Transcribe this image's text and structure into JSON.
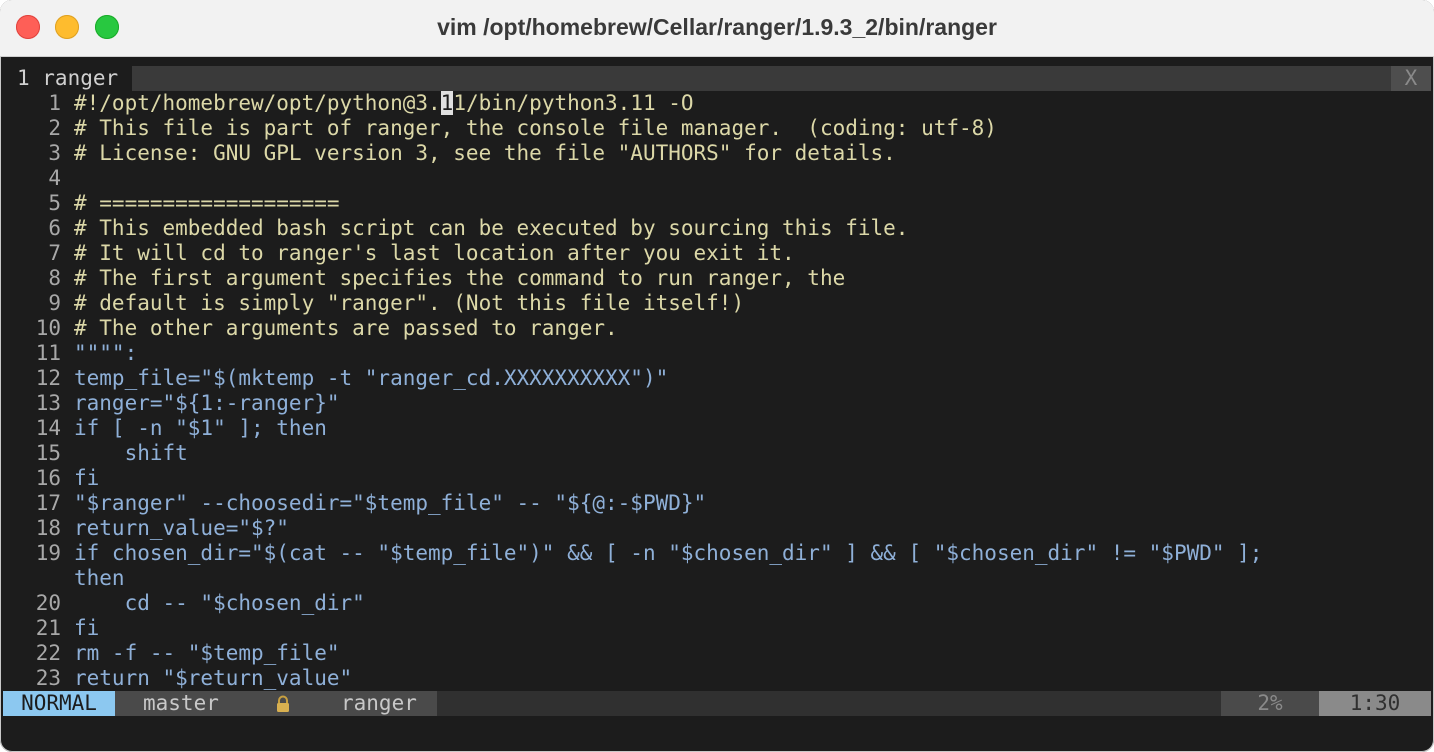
{
  "window": {
    "title": "vim /opt/homebrew/Cellar/ranger/1.9.3_2/bin/ranger"
  },
  "tabline": {
    "active_tab": "1 ranger",
    "close_label": "X"
  },
  "code": [
    {
      "n": "1",
      "pre": "#!/opt/homebrew/opt/python@3.",
      "cur": "1",
      "post": "1/bin/python3.11 -O",
      "kind": "cmt"
    },
    {
      "n": "2",
      "text": "# This file is part of ranger, the console file manager.  (coding: utf-8)",
      "kind": "cmt"
    },
    {
      "n": "3",
      "text": "# License: GNU GPL version 3, see the file \"AUTHORS\" for details.",
      "kind": "cmt"
    },
    {
      "n": "4",
      "text": "",
      "kind": "cmt"
    },
    {
      "n": "5",
      "text": "# ===================",
      "kind": "cmt"
    },
    {
      "n": "6",
      "text": "# This embedded bash script can be executed by sourcing this file.",
      "kind": "cmt"
    },
    {
      "n": "7",
      "text": "# It will cd to ranger's last location after you exit it.",
      "kind": "cmt"
    },
    {
      "n": "8",
      "text": "# The first argument specifies the command to run ranger, the",
      "kind": "cmt"
    },
    {
      "n": "9",
      "text": "# default is simply \"ranger\". (Not this file itself!)",
      "kind": "cmt"
    },
    {
      "n": "10",
      "text": "# The other arguments are passed to ranger.",
      "kind": "cmt"
    },
    {
      "n": "11",
      "text": "\"\"\"\":",
      "kind": "sh"
    },
    {
      "n": "12",
      "text": "temp_file=\"$(mktemp -t \"ranger_cd.XXXXXXXXXX\")\"",
      "kind": "sh"
    },
    {
      "n": "13",
      "text": "ranger=\"${1:-ranger}\"",
      "kind": "sh"
    },
    {
      "n": "14",
      "text": "if [ -n \"$1\" ]; then",
      "kind": "sh"
    },
    {
      "n": "15",
      "text": "    shift",
      "kind": "sh"
    },
    {
      "n": "16",
      "text": "fi",
      "kind": "sh"
    },
    {
      "n": "17",
      "text": "\"$ranger\" --choosedir=\"$temp_file\" -- \"${@:-$PWD}\"",
      "kind": "sh"
    },
    {
      "n": "18",
      "text": "return_value=\"$?\"",
      "kind": "sh"
    },
    {
      "n": "19",
      "text": "if chosen_dir=\"$(cat -- \"$temp_file\")\" && [ -n \"$chosen_dir\" ] && [ \"$chosen_dir\" != \"$PWD\" ];",
      "kind": "sh"
    },
    {
      "n": "",
      "text": "then",
      "kind": "sh"
    },
    {
      "n": "20",
      "text": "    cd -- \"$chosen_dir\"",
      "kind": "sh"
    },
    {
      "n": "21",
      "text": "fi",
      "kind": "sh"
    },
    {
      "n": "22",
      "text": "rm -f -- \"$temp_file\"",
      "kind": "sh"
    },
    {
      "n": "23",
      "text": "return \"$return_value\"",
      "kind": "sh"
    }
  ],
  "statusline": {
    "mode": "NORMAL",
    "branch": "master",
    "lock_icon": "lock-icon",
    "filename": "ranger",
    "percent": "2%",
    "position": "1:30"
  }
}
